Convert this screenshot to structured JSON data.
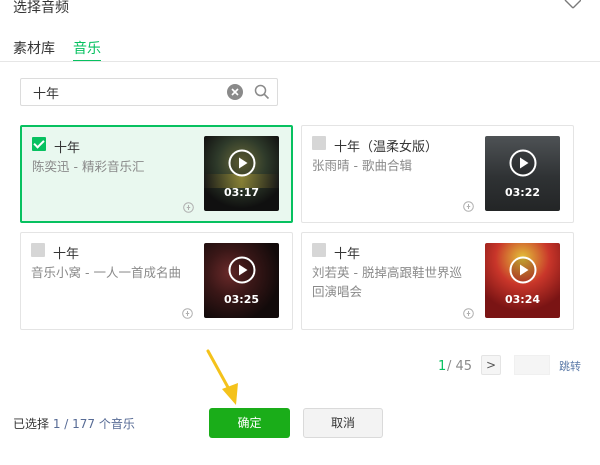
{
  "dialog": {
    "title": "选择音频",
    "close_icon": "close-icon"
  },
  "tabs": [
    {
      "label": "素材库",
      "active": false
    },
    {
      "label": "音乐",
      "active": true
    }
  ],
  "search": {
    "value": "十年",
    "placeholder": ""
  },
  "colors": {
    "accent": "#07c160",
    "primary_button": "#1aad19",
    "link": "#576b95"
  },
  "tracks": [
    {
      "title": "十年",
      "subtitle": "陈奕迅 - 精彩音乐汇",
      "duration": "03:17",
      "selected": true
    },
    {
      "title": "十年（温柔女版）",
      "subtitle": "张雨晴 - 歌曲合辑",
      "duration": "03:22",
      "selected": false
    },
    {
      "title": "十年",
      "subtitle": "音乐小窝 - 一人一首成名曲",
      "duration": "03:25",
      "selected": false
    },
    {
      "title": "十年",
      "subtitle": "刘若英 - 脱掉高跟鞋世界巡回演唱会",
      "duration": "03:24",
      "selected": false
    }
  ],
  "pagination": {
    "current": "1",
    "total": "/ 45",
    "next_label": ">",
    "jump_label": "跳转"
  },
  "footer": {
    "selected_prefix": "已选择",
    "selected_count": "1 / 177 个音乐",
    "ok_label": "确定",
    "cancel_label": "取消"
  }
}
